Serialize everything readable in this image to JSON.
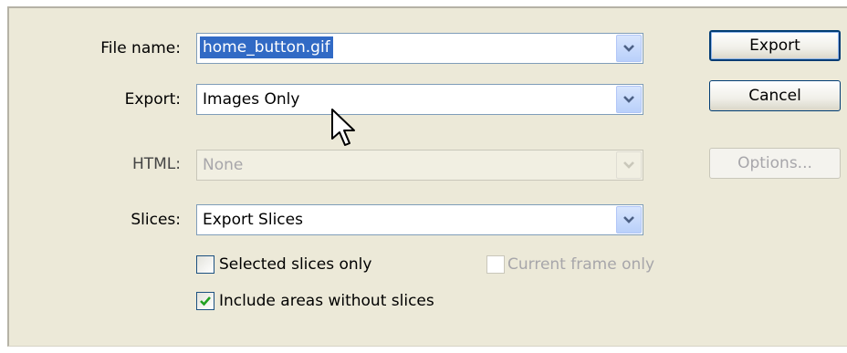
{
  "dialog": {
    "file_name": {
      "label": "File name:",
      "value": "home_button.gif"
    },
    "export": {
      "label": "Export:",
      "value": "Images Only"
    },
    "html": {
      "label": "HTML:",
      "value": "None",
      "disabled": true
    },
    "slices": {
      "label": "Slices:",
      "value": "Export Slices"
    },
    "checkboxes": {
      "selected_slices_only": {
        "label": "Selected slices only",
        "checked": false
      },
      "current_frame_only": {
        "label": "Current frame only",
        "checked": false,
        "disabled": true
      },
      "include_areas_without_slices": {
        "label": "Include areas without slices",
        "checked": true
      }
    },
    "buttons": {
      "export": "Export",
      "cancel": "Cancel",
      "options": "Options..."
    }
  },
  "colors": {
    "panel_bg": "#ece9d8",
    "selection": "#316ac5",
    "button_border": "#003c74",
    "check_green": "#21a121"
  },
  "icons": {
    "dropdown": "chevron-down-icon",
    "cursor": "mouse-pointer-icon",
    "check": "checkmark-icon"
  }
}
